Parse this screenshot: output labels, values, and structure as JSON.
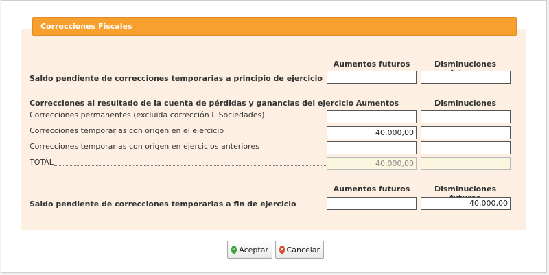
{
  "panel": {
    "title": "Correcciones Fiscales"
  },
  "section_start": {
    "col_increase": "Aumentos futuros",
    "col_decrease": "Disminuciones futuras",
    "row_label": "Saldo pendiente de correcciones temporarias a principio de ejercicio",
    "increase_value": "",
    "decrease_value": ""
  },
  "section_result": {
    "heading": "Correcciones al resultado de la cuenta de pérdidas y ganancias del ejercicio",
    "col_increase": "Aumentos",
    "col_decrease": "Disminuciones",
    "rows": [
      {
        "label": "Correcciones permanentes (excluida corrección I. Sociedades)",
        "increase": "",
        "decrease": ""
      },
      {
        "label": "Correcciones temporarias con origen en el ejercicio",
        "increase": "40.000,00",
        "decrease": ""
      },
      {
        "label": "Correcciones temporarias con origen en ejercicios anteriores",
        "increase": "",
        "decrease": ""
      },
      {
        "label": "TOTAL",
        "increase": "40.000,00",
        "decrease": ""
      }
    ]
  },
  "section_end": {
    "col_increase": "Aumentos futuros",
    "col_decrease": "Disminuciones futuras",
    "row_label": "Saldo pendiente de correcciones temporarias a fin de ejercicio",
    "increase_value": "",
    "decrease_value": "40.000,00"
  },
  "buttons": {
    "accept": "Aceptar",
    "cancel": "Cancelar"
  },
  "icons": {
    "accept": "check-circle-icon",
    "cancel": "cancel-circle-icon"
  }
}
